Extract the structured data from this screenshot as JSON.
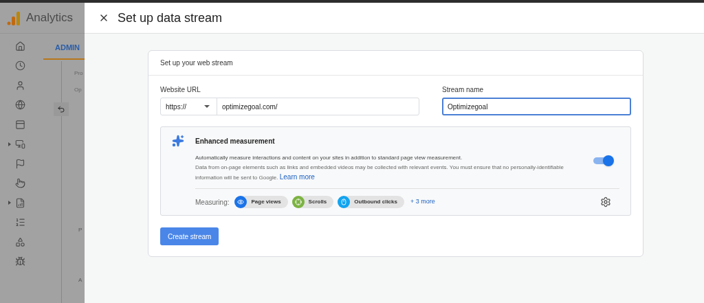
{
  "background": {
    "app_name": "Analytics",
    "tab": "ADMIN",
    "nav_items": [
      {
        "kind": "home",
        "expandable": false
      },
      {
        "kind": "clock",
        "expandable": false
      },
      {
        "kind": "person",
        "expandable": false
      },
      {
        "kind": "globe",
        "expandable": false
      },
      {
        "kind": "panel",
        "expandable": false
      },
      {
        "kind": "devices",
        "expandable": true
      },
      {
        "kind": "flag",
        "expandable": false
      },
      {
        "kind": "touch",
        "expandable": false
      },
      {
        "kind": "report",
        "expandable": true
      },
      {
        "kind": "list",
        "expandable": false
      },
      {
        "kind": "shapes",
        "expandable": false
      },
      {
        "kind": "bug",
        "expandable": false
      }
    ],
    "labels": [
      "Pro",
      "Op",
      "P",
      "A"
    ]
  },
  "drawer": {
    "title": "Set up data stream"
  },
  "card": {
    "title": "Set up your web stream",
    "website_url": {
      "label": "Website URL",
      "protocol": "https://",
      "value": "optimizegoal.com/"
    },
    "stream_name": {
      "label": "Stream name",
      "value": "Optimizegoal",
      "focused": true
    },
    "enhanced": {
      "title": "Enhanced measurement",
      "description": "Automatically measure interactions and content on your sites in addition to standard page view measurement.",
      "note": "Data from on-page elements such as links and embedded videos may be collected with relevant events. You must ensure that no personally-identifiable information will be sent to Google.",
      "link": "Learn more",
      "on": true,
      "measuring_label": "Measuring:",
      "chips": [
        {
          "kind": "eye",
          "label": "Page views",
          "color": "#1a73e8"
        },
        {
          "kind": "target",
          "label": "Scrolls",
          "color": "#7cb342"
        },
        {
          "kind": "mouse",
          "label": "Outbound clicks",
          "color": "#12a4f0"
        }
      ],
      "more": "+ 3 more"
    },
    "button": "Create stream"
  }
}
